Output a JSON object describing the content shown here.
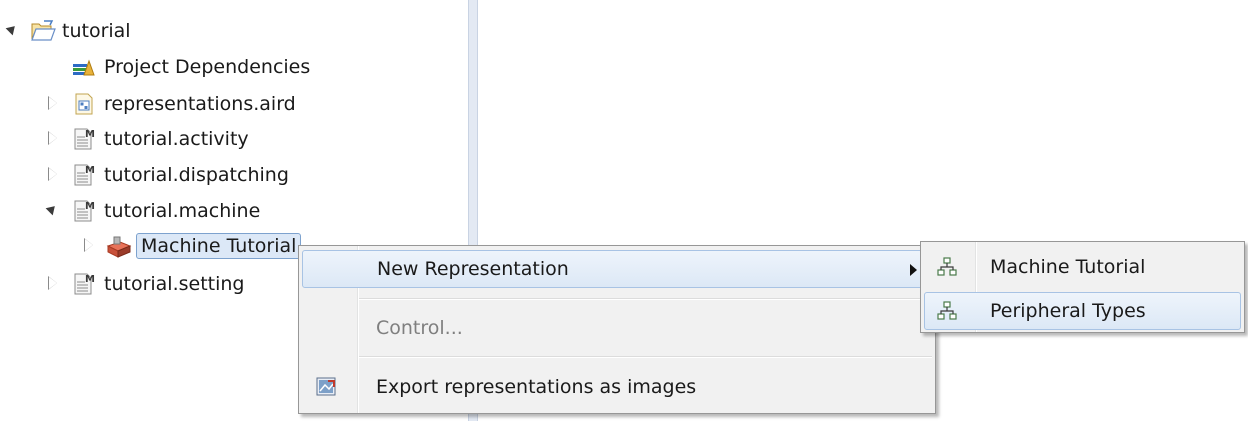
{
  "tree": {
    "project": {
      "label": "tutorial",
      "icon": "open-project-folder-icon"
    },
    "items": [
      {
        "label": "Project Dependencies",
        "icon": "project-dependencies-icon"
      },
      {
        "label": "representations.aird",
        "icon": "aird-file-icon"
      },
      {
        "label": "tutorial.activity",
        "icon": "model-file-icon"
      },
      {
        "label": "tutorial.dispatching",
        "icon": "model-file-icon"
      },
      {
        "label": "tutorial.machine",
        "icon": "model-file-icon"
      },
      {
        "label": "Machine Tutorial",
        "icon": "machine-object-icon"
      },
      {
        "label": "tutorial.setting",
        "icon": "model-file-icon"
      }
    ]
  },
  "context_menu": {
    "new_representation": "New Representation",
    "control": "Control...",
    "export": "Export representations as images"
  },
  "submenu": {
    "items": [
      {
        "label": "Machine Tutorial",
        "icon": "diagram-representation-icon"
      },
      {
        "label": "Peripheral Types",
        "icon": "diagram-representation-icon"
      }
    ]
  }
}
